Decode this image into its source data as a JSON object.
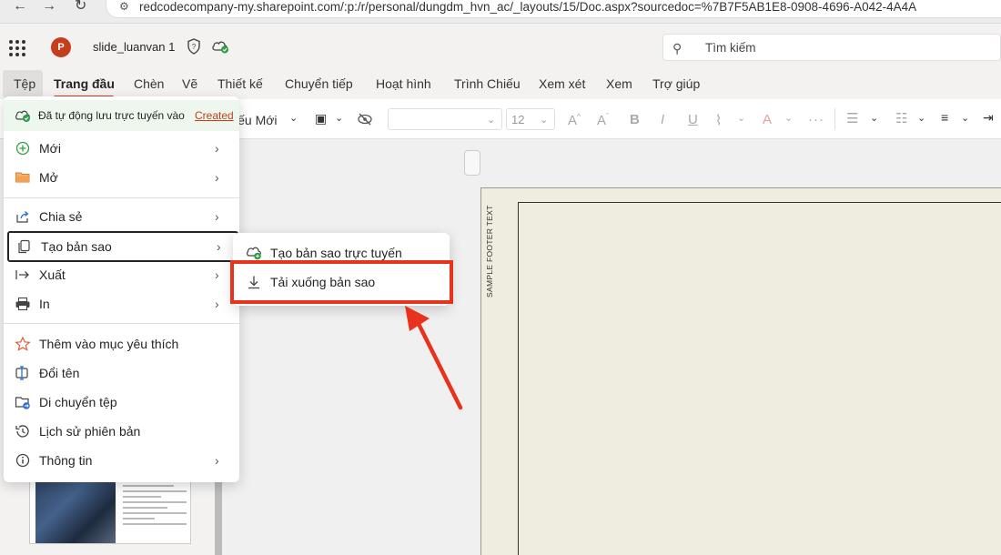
{
  "browser": {
    "url": "redcodecompany-my.sharepoint.com/:p:/r/personal/dungdm_hvn_ac/_layouts/15/Doc.aspx?sourcedoc=%7B7F5AB1E8-0908-4696-A042-4A4A"
  },
  "header": {
    "app_logo": "P",
    "doc_title": "slide_luanvan 1",
    "search_placeholder": "Tìm kiếm"
  },
  "tabs": [
    {
      "label": "Tệp"
    },
    {
      "label": "Trang đầu"
    },
    {
      "label": "Chèn"
    },
    {
      "label": "Vẽ"
    },
    {
      "label": "Thiết kế"
    },
    {
      "label": "Chuyển tiếp"
    },
    {
      "label": "Hoạt hình"
    },
    {
      "label": "Trình Chiếu"
    },
    {
      "label": "Xem xét"
    },
    {
      "label": "Xem"
    },
    {
      "label": "Trợ giúp"
    }
  ],
  "ribbon": {
    "new_slide_partial": "iếu Mới",
    "font_size": "12"
  },
  "file_menu": {
    "autosave_text": "Đã tự động lưu trực tuyến vào",
    "autosave_link": "Created",
    "items": [
      {
        "label": "Mới",
        "icon": "plus-circle-icon"
      },
      {
        "label": "Mở",
        "icon": "folder-icon"
      },
      {
        "label": "Chia sẻ",
        "icon": "share-icon"
      },
      {
        "label": "Tạo bản sao",
        "icon": "copy-icon"
      },
      {
        "label": "Xuất",
        "icon": "export-icon"
      },
      {
        "label": "In",
        "icon": "printer-icon"
      },
      {
        "label": "Thêm vào mục yêu thích",
        "icon": "star-icon"
      },
      {
        "label": "Đổi tên",
        "icon": "rename-icon"
      },
      {
        "label": "Di chuyển tệp",
        "icon": "move-folder-icon"
      },
      {
        "label": "Lịch sử phiên bản",
        "icon": "history-icon"
      },
      {
        "label": "Thông tin",
        "icon": "info-icon"
      }
    ]
  },
  "submenu": {
    "items": [
      {
        "label": "Tạo bản sao trực tuyến",
        "icon": "cloud-copy-icon"
      },
      {
        "label": "Tải xuống bản sao",
        "icon": "download-icon"
      }
    ]
  },
  "slide": {
    "footer_text": "SAMPLE FOOTER TEXT"
  },
  "colors": {
    "accent": "#c43e1c",
    "highlight": "#e8321b",
    "autosave_bg": "#eef7ee"
  }
}
